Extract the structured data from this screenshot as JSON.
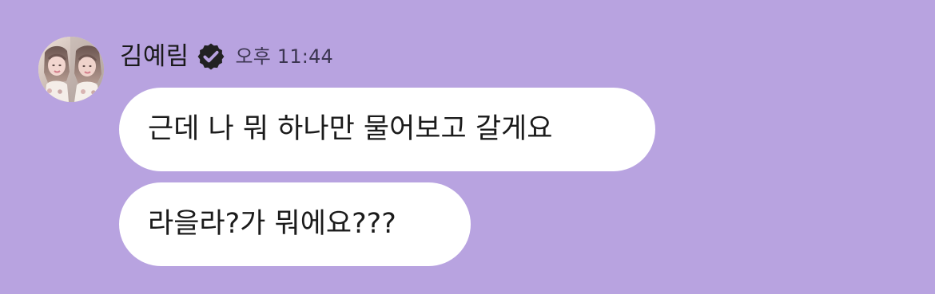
{
  "chat": {
    "sender": {
      "name": "김예림",
      "avatar": "profile-photo",
      "badge_icon": "verified-badge-icon"
    },
    "timestamp": "오후 11:44",
    "messages": [
      {
        "text": "근데 나 뭐 하나만 물어보고 갈게요"
      },
      {
        "text": "라을라?가 뭐에요???"
      }
    ]
  },
  "colors": {
    "background": "#b8a3e0",
    "bubble": "#ffffff",
    "text": "#1b1b1b",
    "badge": "#222222"
  }
}
